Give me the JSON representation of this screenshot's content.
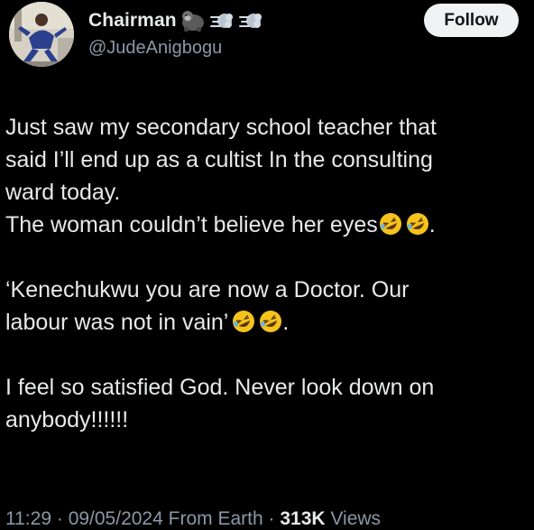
{
  "author": {
    "display_name": "Chairman",
    "handle": "@JudeAnigbogu",
    "name_icons": [
      "gorilla-icon",
      "dashing-away-icon",
      "dashing-away-icon"
    ]
  },
  "follow_label": "Follow",
  "tweet": {
    "paragraphs": [
      {
        "lines": [
          "Just saw my secondary school teacher that",
          "said I’ll end up as a cultist In the consulting",
          "ward today."
        ]
      },
      {
        "lines": [
          "The woman couldn’t believe her eyes"
        ],
        "tail": "."
      },
      {
        "lines": [
          "‘Kenechukwu you are now a Doctor. Our",
          "labour was not in vain’"
        ],
        "tail": "."
      },
      {
        "lines": [
          "I feel so satisfied God. Never look down on",
          "anybody!!!!!!"
        ]
      }
    ],
    "laugh_icon": "rolling-on-floor-laughing-icon"
  },
  "meta": {
    "time": "11:29",
    "separator": "·",
    "date": "09/05/2024",
    "source": "From Earth",
    "views_count": "313K",
    "views_label": "Views"
  },
  "colors": {
    "background": "#000000",
    "text": "#e7e9ea",
    "secondary": "#8b98a5",
    "follow_bg": "#eff3f4"
  }
}
